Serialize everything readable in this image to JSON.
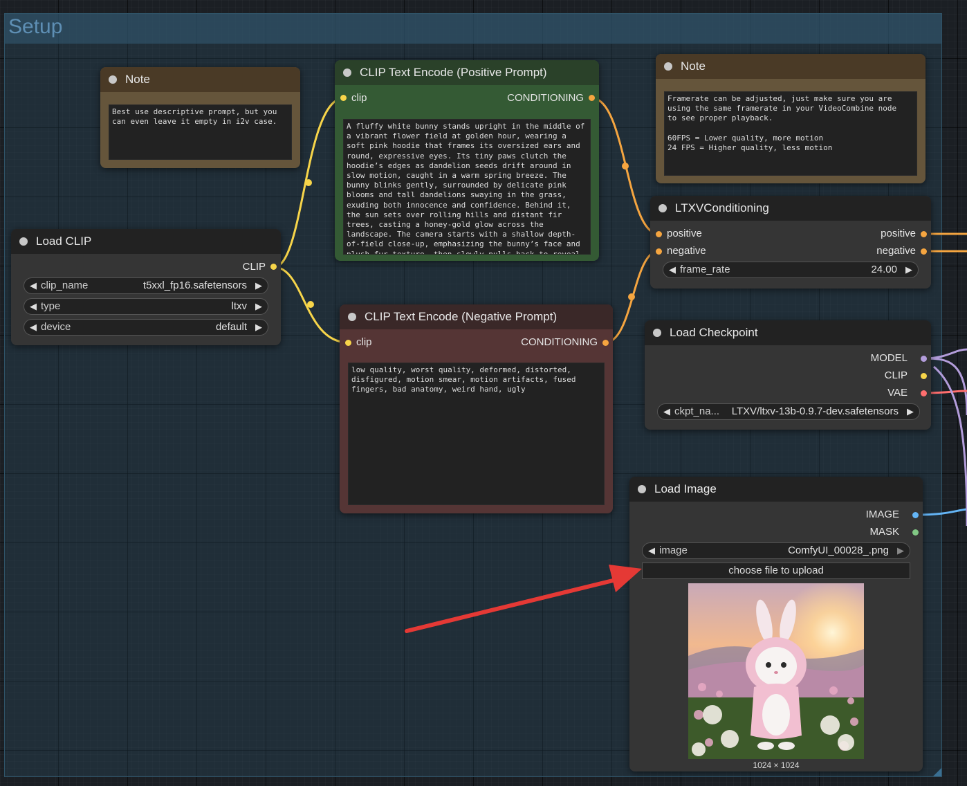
{
  "group": {
    "title": "Setup"
  },
  "note_left": {
    "title": "Note",
    "text": "Best use descriptive prompt, but you\ncan even leave it empty in i2v case."
  },
  "note_right": {
    "title": "Note",
    "text": "Framerate can be adjusted, just make sure you are\nusing the same framerate in your VideoCombine node\nto see proper playback.\n\n60FPS = Lower quality, more motion\n24 FPS = Higher quality, less motion"
  },
  "load_clip": {
    "title": "Load CLIP",
    "output": "CLIP",
    "widgets": [
      {
        "label": "clip_name",
        "value": "t5xxl_fp16.safetensors"
      },
      {
        "label": "type",
        "value": "ltxv"
      },
      {
        "label": "device",
        "value": "default"
      }
    ]
  },
  "pos_prompt": {
    "title": "CLIP Text Encode (Positive Prompt)",
    "input": "clip",
    "output": "CONDITIONING",
    "text": "A fluffy white bunny stands upright in the middle of a vibrant flower field at golden hour, wearing a soft pink hoodie that frames its oversized ears and round, expressive eyes. Its tiny paws clutch the hoodie’s edges as dandelion seeds drift around in slow motion, caught in a warm spring breeze. The bunny blinks gently, surrounded by delicate pink blooms and tall dandelions swaying in the grass, exuding both innocence and confidence. Behind it, the sun sets over rolling hills and distant fir trees, casting a honey-gold glow across the landscape. The camera starts with a shallow depth-of-field close-up, emphasizing the bunny’s face and plush fur texture, then slowly pulls back to reveal"
  },
  "neg_prompt": {
    "title": "CLIP Text Encode (Negative Prompt)",
    "input": "clip",
    "output": "CONDITIONING",
    "text": "low quality, worst quality, deformed, distorted,\ndisfigured, motion smear, motion artifacts, fused\nfingers, bad anatomy, weird hand, ugly"
  },
  "ltxv": {
    "title": "LTXVConditioning",
    "inputs": [
      "positive",
      "negative"
    ],
    "outputs": [
      "positive",
      "negative"
    ],
    "widget": {
      "label": "frame_rate",
      "value": "24.00"
    }
  },
  "checkpoint": {
    "title": "Load Checkpoint",
    "outputs": [
      "MODEL",
      "CLIP",
      "VAE"
    ],
    "widget": {
      "label": "ckpt_na...",
      "value": "LTXV/ltxv-13b-0.9.7-dev.safetensors"
    }
  },
  "load_image": {
    "title": "Load Image",
    "outputs": [
      "IMAGE",
      "MASK"
    ],
    "widget": {
      "label": "image",
      "value": "ComfyUI_00028_.png"
    },
    "upload_label": "choose file to upload",
    "image_caption": "1024 × 1024"
  },
  "colors": {
    "clip": "#f7d54a",
    "conditioning": "#f5a540",
    "model": "#b39ddb",
    "vae": "#ff6e6e",
    "image": "#64b5f6",
    "mask": "#81c784",
    "arrow": "#e53935"
  }
}
